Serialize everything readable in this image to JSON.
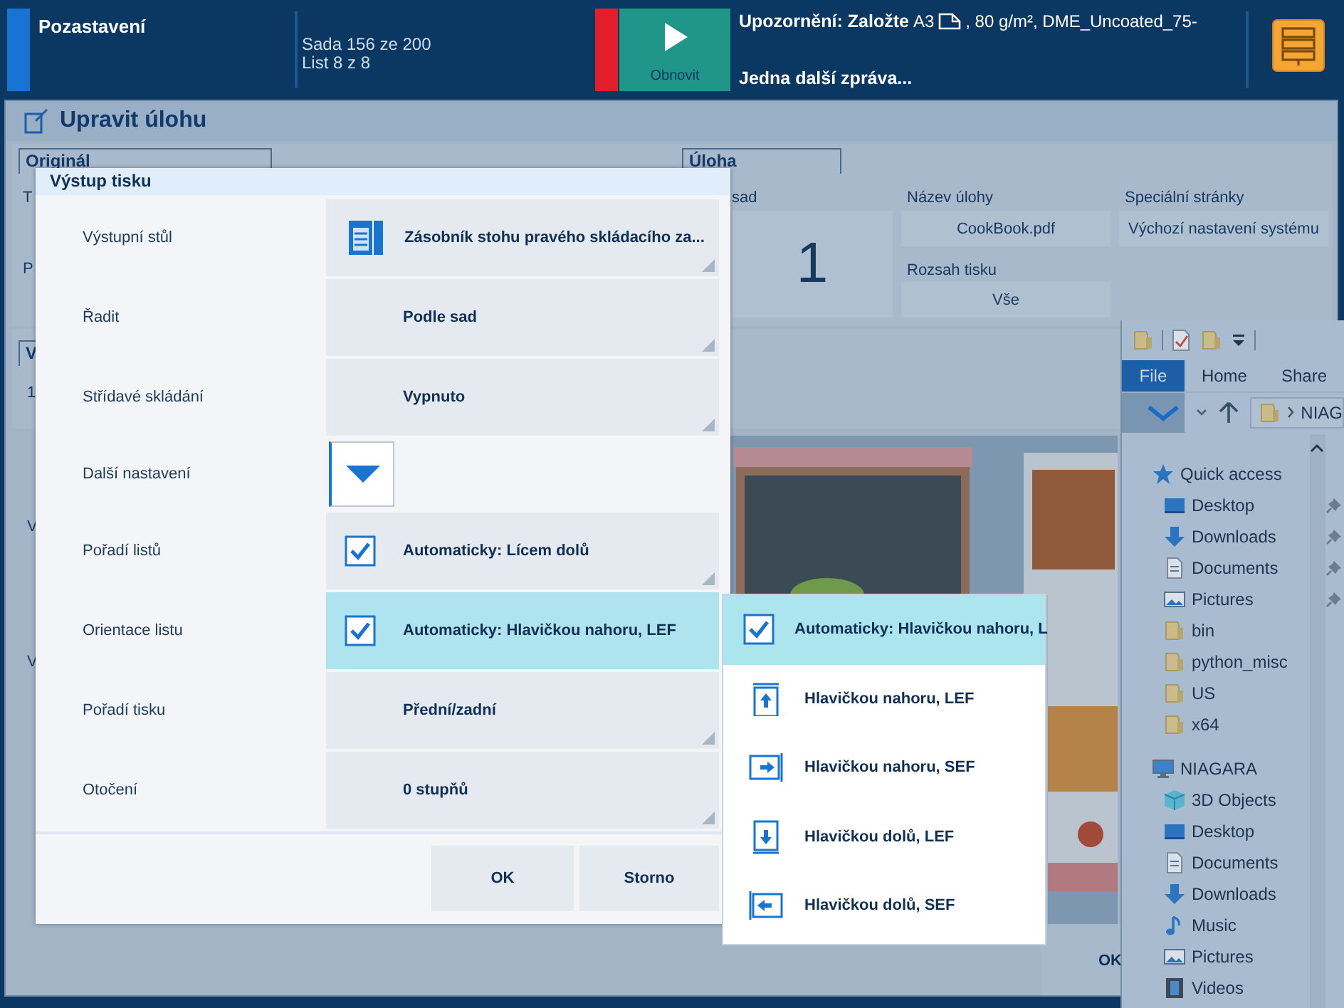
{
  "top_bar": {
    "status": "Pozastavení",
    "set_info": "Sada 156 ze 200",
    "sheet_info": "List 8 z 8",
    "refresh_button": "Obnovit",
    "message_title": "Upozornění: Založte",
    "message_size": "A3",
    "message_details": ", 80 g/m², DME_Uncoated_75-",
    "more_messages": "Jedna další zpráva..."
  },
  "edit_job": {
    "title": "Upravit úlohu",
    "original_section": "Originál",
    "job_section": "Úloha",
    "lower_section": "V",
    "left_labels": [
      {
        "text": "T"
      },
      {
        "text": "P"
      },
      {
        "text": "1"
      },
      {
        "text": "V"
      },
      {
        "text": "V"
      }
    ],
    "job_fields": [
      {
        "kind": "big",
        "label": "sad",
        "value": "1"
      },
      {
        "kind": "field",
        "label": "Název úlohy",
        "value": "CookBook.pdf"
      },
      {
        "kind": "field",
        "label": "Rozsah tisku",
        "value": "Vše"
      },
      {
        "kind": "field",
        "label": "Speciální stránky",
        "value": "Výchozí nastavení systému"
      }
    ],
    "ok_button": "OK"
  },
  "print_output_dialog": {
    "title": "Výstup tisku",
    "rows": [
      {
        "kind": "icon-select",
        "label": "Výstupní stůl",
        "value": "Zásobník stohu pravého skládacího za...",
        "selected": false
      },
      {
        "kind": "select",
        "label": "Řadit",
        "value": "Podle sad",
        "selected": false
      },
      {
        "kind": "select",
        "label": "Střídavé skládání",
        "value": "Vypnuto",
        "selected": false
      },
      {
        "kind": "toggle",
        "label": "Další nastavení",
        "expanded": false
      },
      {
        "kind": "check-select",
        "label": "Pořadí listů",
        "value": "Automaticky: Lícem dolů",
        "checked": true,
        "selected": false
      },
      {
        "kind": "check-select",
        "label": "Orientace listu",
        "value": "Automaticky: Hlavičkou nahoru, LEF",
        "checked": true,
        "selected": true
      },
      {
        "kind": "select",
        "label": "Pořadí tisku",
        "value": "Přední/zadní",
        "selected": false
      },
      {
        "kind": "select",
        "label": "Otočení",
        "value": "0 stupňů",
        "selected": false
      }
    ],
    "buttons": [
      "OK",
      "Storno"
    ]
  },
  "orientation_options": [
    {
      "kind": "check",
      "label": "Automaticky: Hlavičkou nahoru, L",
      "checked": true,
      "selected": true
    },
    {
      "kind": "up-lef",
      "label": "Hlavičkou nahoru, LEF",
      "selected": false
    },
    {
      "kind": "up-sef",
      "label": "Hlavičkou nahoru, SEF",
      "selected": false
    },
    {
      "kind": "down-lef",
      "label": "Hlavičkou dolů, LEF",
      "selected": false
    },
    {
      "kind": "down-sef",
      "label": "Hlavičkou dolů, SEF",
      "selected": false
    }
  ],
  "explorer": {
    "tabs": [
      {
        "label": "File",
        "selected": true
      },
      {
        "label": "Home",
        "selected": false
      },
      {
        "label": "Share",
        "selected": false
      }
    ],
    "address": "NIAG",
    "tree": [
      {
        "kind": "star",
        "label": "Quick access",
        "children": [
          {
            "kind": "desktop",
            "label": "Desktop",
            "pinned": true
          },
          {
            "kind": "download",
            "label": "Downloads",
            "pinned": true
          },
          {
            "kind": "document",
            "label": "Documents",
            "pinned": true
          },
          {
            "kind": "pictures",
            "label": "Pictures",
            "pinned": true
          },
          {
            "kind": "folder",
            "label": "bin",
            "pinned": false
          },
          {
            "kind": "folder",
            "label": "python_misc",
            "pinned": false
          },
          {
            "kind": "folder",
            "label": "US",
            "pinned": false
          },
          {
            "kind": "folder",
            "label": "x64",
            "pinned": false
          }
        ]
      },
      {
        "kind": "computer",
        "label": "NIAGARA",
        "children": [
          {
            "kind": "cube",
            "label": "3D Objects",
            "pinned": false
          },
          {
            "kind": "desktop",
            "label": "Desktop",
            "pinned": false
          },
          {
            "kind": "document",
            "label": "Documents",
            "pinned": false
          },
          {
            "kind": "download",
            "label": "Downloads",
            "pinned": false
          },
          {
            "kind": "music",
            "label": "Music",
            "pinned": false
          },
          {
            "kind": "pictures",
            "label": "Pictures",
            "pinned": false
          },
          {
            "kind": "video",
            "label": "Videos",
            "pinned": false
          }
        ]
      }
    ]
  }
}
